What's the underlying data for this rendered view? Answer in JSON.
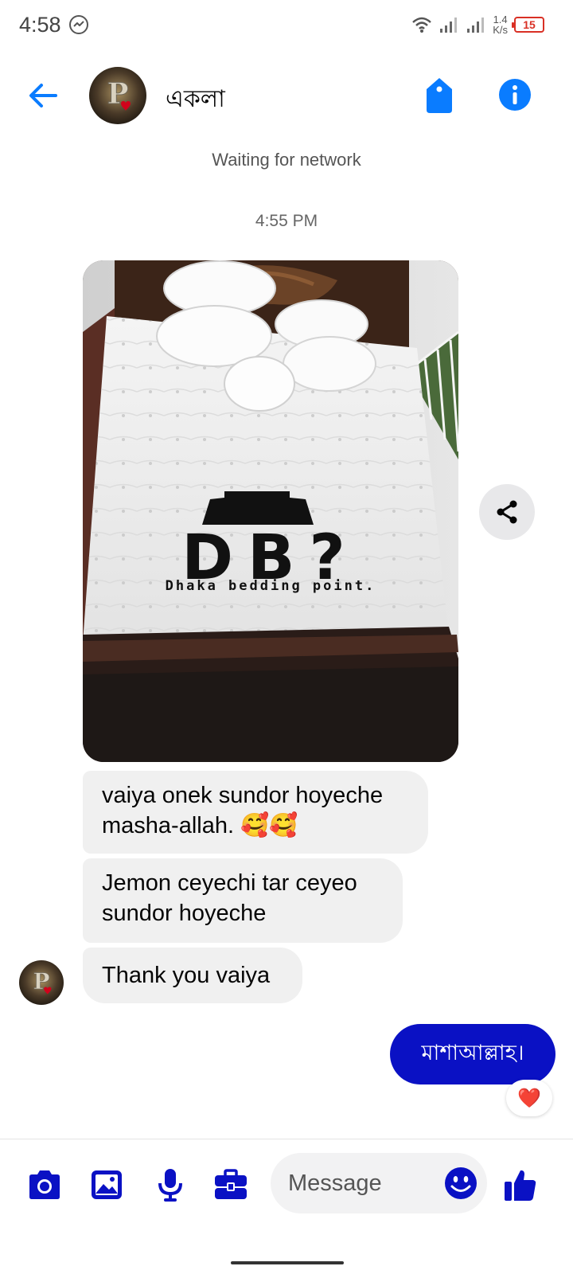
{
  "status_bar": {
    "time": "4:58",
    "speed_value": "1.4",
    "speed_unit": "K/s",
    "battery": "15"
  },
  "header": {
    "contact_name": "একলা",
    "avatar_letter": "P"
  },
  "conversation": {
    "network_status": "Waiting for network",
    "timestamp": "4:55 PM",
    "photo": {
      "logo_text": "DB?",
      "logo_caption": "Dhaka bedding point."
    },
    "messages": [
      {
        "text": "vaiya onek sundor hoyeche masha-allah. 🥰🥰",
        "from": "contact"
      },
      {
        "text": "Jemon ceyechi tar ceyeo sundor hoyeche",
        "from": "contact"
      },
      {
        "text": "Thank you vaiya",
        "from": "contact"
      },
      {
        "text": "মাশাআল্লাহ।",
        "from": "me",
        "reaction": "❤️"
      }
    ]
  },
  "composer": {
    "placeholder": "Message"
  },
  "colors": {
    "accent": "#0a11c4",
    "header_blue": "#0a7cff",
    "bubble_gray": "#f0f0f0"
  },
  "icons": [
    "back-arrow-icon",
    "tag-icon",
    "info-icon",
    "share-icon",
    "camera-icon",
    "gallery-icon",
    "microphone-icon",
    "briefcase-icon",
    "emoji-icon",
    "thumbs-up-icon"
  ]
}
